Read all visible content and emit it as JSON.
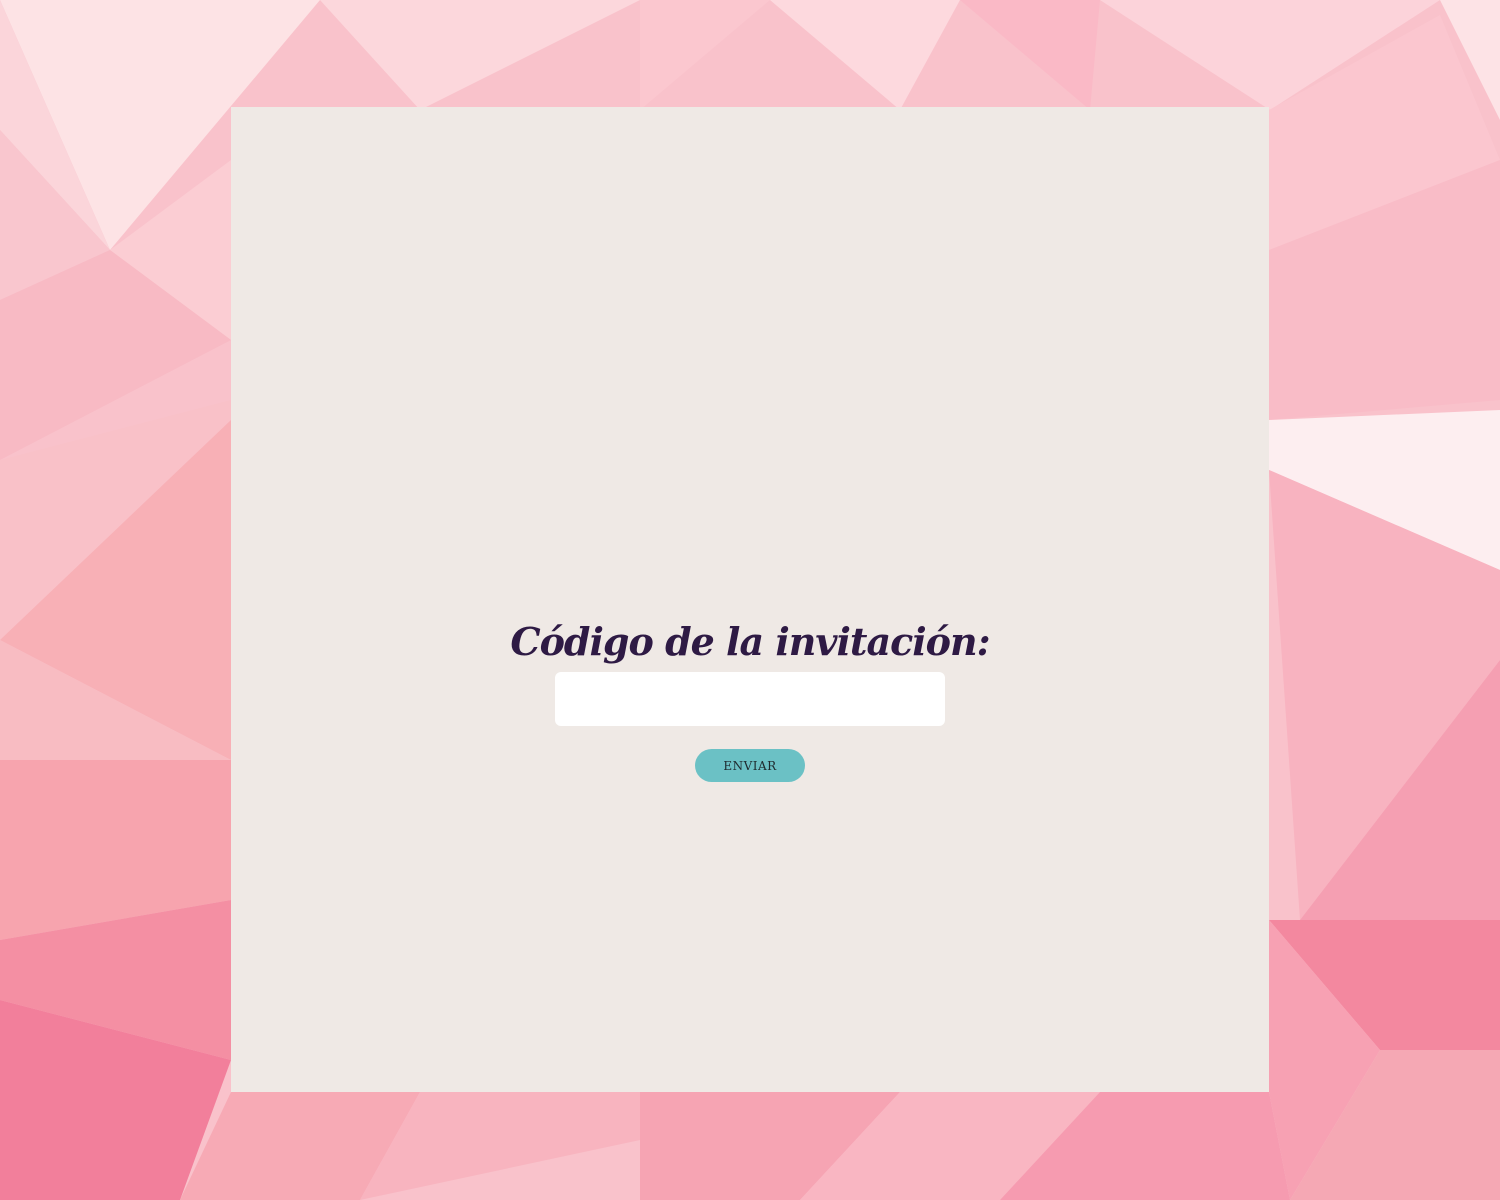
{
  "form": {
    "title": "Código de la invitación:",
    "code_input": {
      "value": "",
      "placeholder": ""
    },
    "submit_label": "ENVIAR"
  },
  "colors": {
    "card_background": "#efe9e5",
    "title_text": "#2e1a44",
    "button_background": "#6bc1c5",
    "page_background": "#f7b4c2"
  }
}
